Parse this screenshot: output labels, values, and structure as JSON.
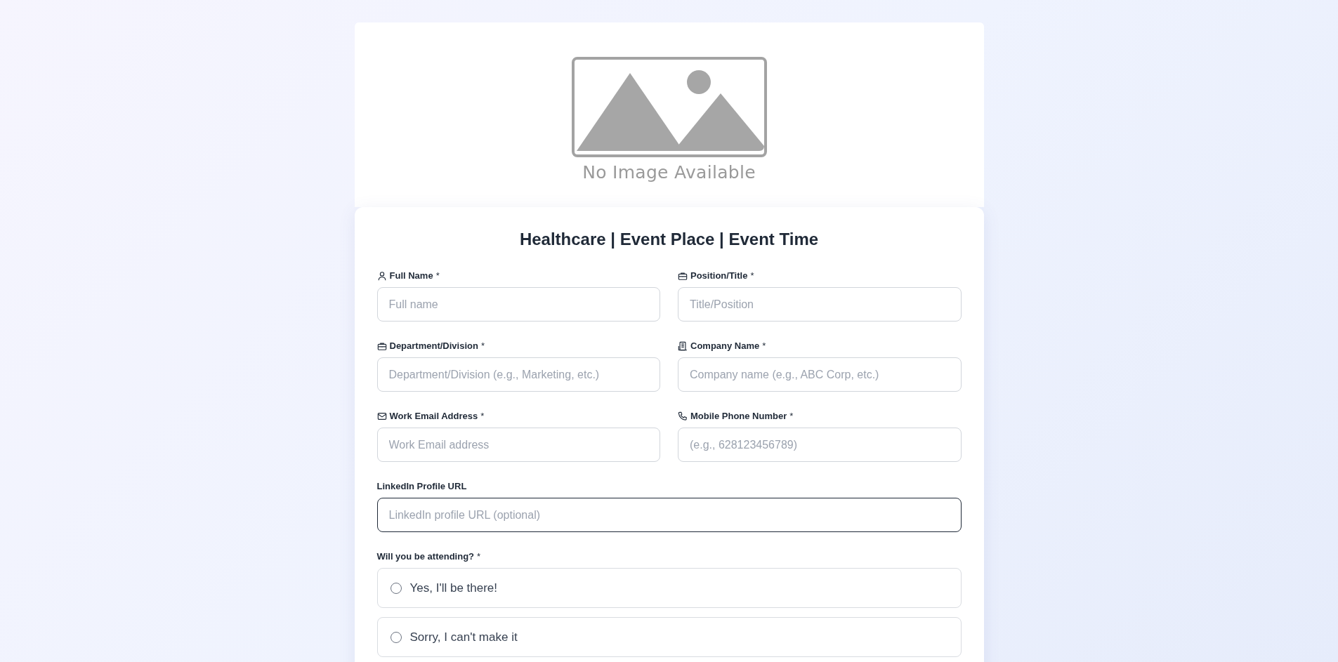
{
  "banner": {
    "caption": "No Image Available"
  },
  "form": {
    "title": "Healthcare | Event Place | Event Time",
    "fields": [
      {
        "kind": "person",
        "label": "Full Name",
        "required": "*",
        "placeholder": "Full name"
      },
      {
        "kind": "briefcase",
        "label": "Position/Title",
        "required": "*",
        "placeholder": "Title/Position"
      },
      {
        "kind": "briefcase",
        "label": "Department/Division",
        "required": "*",
        "placeholder": "Department/Division (e.g., Marketing, etc.)"
      },
      {
        "kind": "building",
        "label": "Company Name",
        "required": "*",
        "placeholder": "Company name (e.g., ABC Corp, etc.)"
      },
      {
        "kind": "mail",
        "label": "Work Email Address",
        "required": "*",
        "placeholder": "Work Email address"
      },
      {
        "kind": "phone",
        "label": "Mobile Phone Number",
        "required": "*",
        "placeholder": "(e.g., 628123456789)"
      }
    ],
    "linkedin": {
      "label": "LinkedIn Profile URL",
      "placeholder": "LinkedIn profile URL (optional)",
      "focused": true
    },
    "attending": {
      "label": "Will you be attending?",
      "required": "*",
      "options": [
        {
          "label": "Yes, I'll be there!",
          "selected": false
        },
        {
          "label": "Sorry, I can't make it",
          "selected": false
        }
      ]
    }
  }
}
